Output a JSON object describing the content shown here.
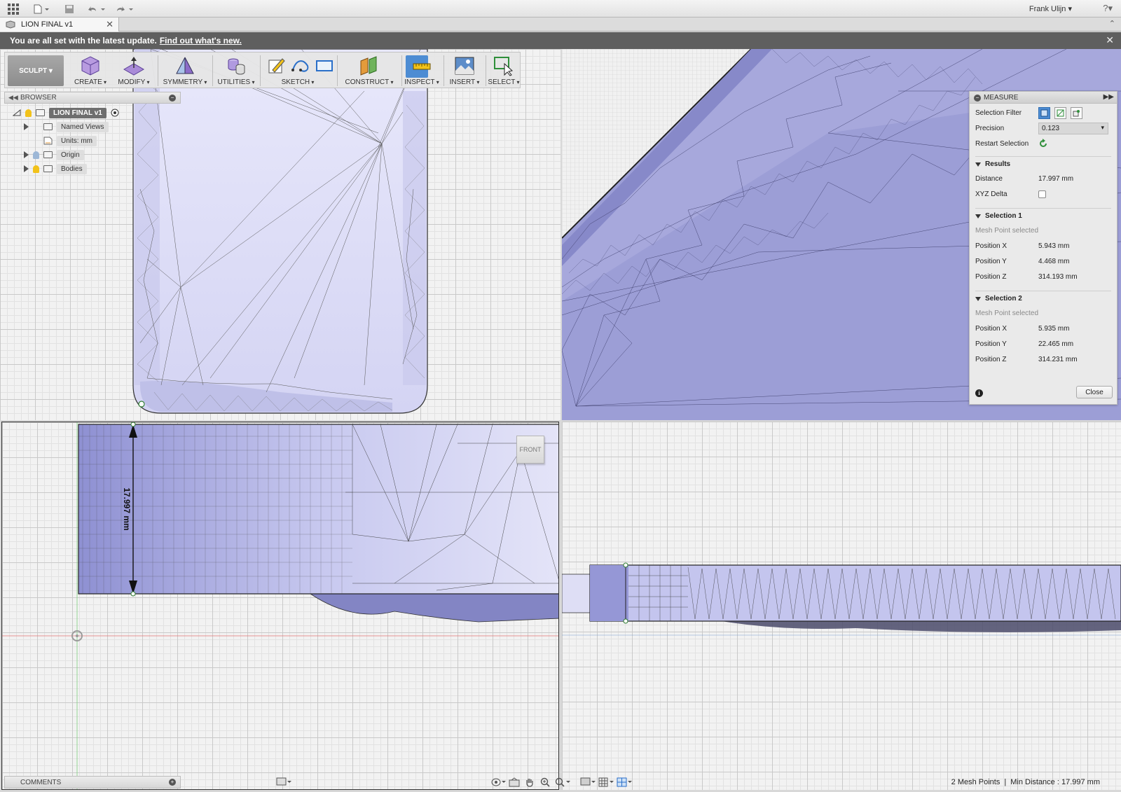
{
  "app": {
    "user": "Frank Ulijn ▾",
    "help_icon": "?▾"
  },
  "tab": {
    "title": "LION  FINAL v1",
    "close": "✕"
  },
  "banner": {
    "message": "You are all set with the latest update.",
    "link": "Find out what's new.",
    "close": "✕"
  },
  "toolbar": {
    "workspace": "SCULPT ▾",
    "groups": [
      "CREATE",
      "MODIFY",
      "SYMMETRY",
      "UTILITIES",
      "SKETCH",
      "CONSTRUCT",
      "INSPECT",
      "INSERT",
      "SELECT"
    ]
  },
  "browser": {
    "title": "BROWSER",
    "root": "LION  FINAL v1",
    "items": [
      "Named Views",
      "Units: mm",
      "Origin",
      "Bodies"
    ]
  },
  "measure": {
    "title": "MEASURE",
    "selection_filter_label": "Selection Filter",
    "precision_label": "Precision",
    "precision_value": "0.123",
    "restart_label": "Restart Selection",
    "results_header": "Results",
    "distance_label": "Distance",
    "distance_value": "17.997 mm",
    "xyz_delta_label": "XYZ Delta",
    "selection1": {
      "header": "Selection 1",
      "hint": "Mesh Point selected",
      "x_label": "Position X",
      "x": "5.943 mm",
      "y_label": "Position Y",
      "y": "4.468 mm",
      "z_label": "Position Z",
      "z": "314.193 mm"
    },
    "selection2": {
      "header": "Selection 2",
      "hint": "Mesh Point selected",
      "x_label": "Position X",
      "x": "5.935 mm",
      "y_label": "Position Y",
      "y": "22.465 mm",
      "z_label": "Position Z",
      "z": "314.231 mm"
    },
    "close_label": "Close"
  },
  "viewport": {
    "dimension_label": "17.997 mm",
    "viewcube_face": "FRONT"
  },
  "bottom": {
    "comments_label": "COMMENTS",
    "status_points": "2 Mesh Points",
    "status_sep": "|",
    "status_distance": "Min Distance : 17.997 mm"
  },
  "colors": {
    "mesh_fill": "#9c9ed6",
    "mesh_light": "#dcdcf6",
    "accent": "#4d8cd3",
    "banner": "#5f5f5f"
  }
}
